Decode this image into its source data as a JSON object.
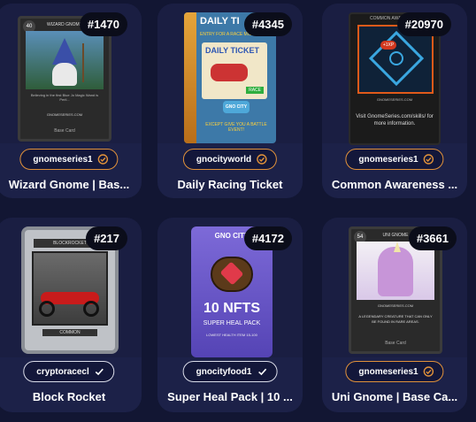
{
  "cards": [
    {
      "number": "#1470",
      "owner": "gnomeseries1",
      "verified_style": "gold",
      "title": "Wizard Gnome | Bas...",
      "art": {
        "header": "WIZARD GNOME",
        "footer": "Believing in the first Blue Jo Magic Wand is Peril...",
        "site": "GNOMESERIES.COM",
        "type": "Base Card",
        "corner": "40"
      }
    },
    {
      "number": "#4345",
      "owner": "gnocityworld",
      "verified_style": "gold",
      "title": "Daily Racing Ticket",
      "art": {
        "header": "DAILY TI",
        "sub": "ENTRY FOR A RACE MISSION",
        "ticket": "DAILY TICKET",
        "race": "RACE",
        "footer": "EXCEPT GIVE YOU A BATTLE EVENT!"
      }
    },
    {
      "number": "#20970",
      "owner": "gnomeseries1",
      "verified_style": "gold",
      "title": "Common Awareness ...",
      "art": {
        "header": "COMMON AWARENESS",
        "site": "GNOMESERIES.COM",
        "footer": "Visit GnomeSeries.com/skills/ for more information."
      }
    },
    {
      "number": "#217",
      "owner": "cryptoracecl",
      "verified_style": "white",
      "title": "Block Rocket",
      "art": {
        "header": "BLOCKROCKET",
        "rarity": "COMMON"
      }
    },
    {
      "number": "#4172",
      "owner": "gnocityfood1",
      "verified_style": "white",
      "title": "Super Heal Pack | 10 ...",
      "art": {
        "logo": "GNO CITY",
        "big": "10 NFTS",
        "sub": "SUPER HEAL PACK",
        "foot": "LOWEST HEALTH ITEM 15-100"
      }
    },
    {
      "number": "#3661",
      "owner": "gnomeseries1",
      "verified_style": "gold",
      "title": "Uni Gnome | Base Ca...",
      "art": {
        "header": "UNI GNOME",
        "site": "GNOMESERIES.COM",
        "footer": "A LEGENDARY CREATURE THAT CAN ONLY BE FOUND IN RARE AREAS.",
        "type": "Base Card",
        "corner": "54"
      }
    }
  ],
  "colors": {
    "gold": "#e0913a",
    "white": "#d9dbe8",
    "bg": "#121633",
    "card": "#1c2148"
  },
  "icons": {
    "gold": "badge-check-icon",
    "white": "check-icon"
  }
}
